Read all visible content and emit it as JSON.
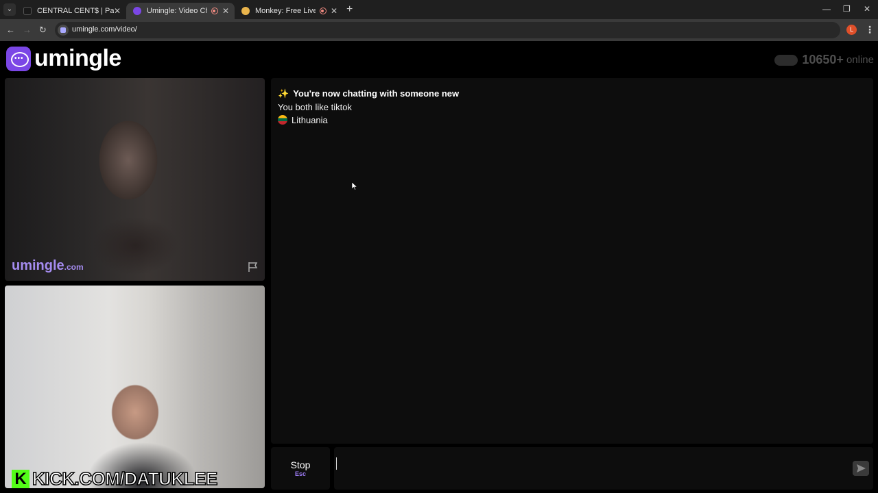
{
  "browser": {
    "tabs": [
      {
        "title": "CENTRAL CENT$ | PackDraw",
        "active": false
      },
      {
        "title": "Umingle: Video Chat with S",
        "active": true
      },
      {
        "title": "Monkey: Free Live Video Ch",
        "active": false
      }
    ],
    "url": "umingle.com/video/",
    "profile_initial": "L"
  },
  "header": {
    "logo_text": "umingle",
    "online_count": "10650+",
    "online_label": "online"
  },
  "stranger_video": {
    "watermark": "umingle",
    "watermark_domain": ".com"
  },
  "self_video": {
    "overlay_icon": "K",
    "overlay_text": "KICK.COM/DATUKLEE"
  },
  "chat": {
    "header": "You're now chatting with someone new",
    "common_interest": "You both like tiktok",
    "country": "Lithuania"
  },
  "controls": {
    "stop_label": "Stop",
    "stop_shortcut": "Esc",
    "message_value": ""
  },
  "colors": {
    "brand": "#7b47e6",
    "accent": "#9b7af2",
    "kick_green": "#53fc18"
  }
}
